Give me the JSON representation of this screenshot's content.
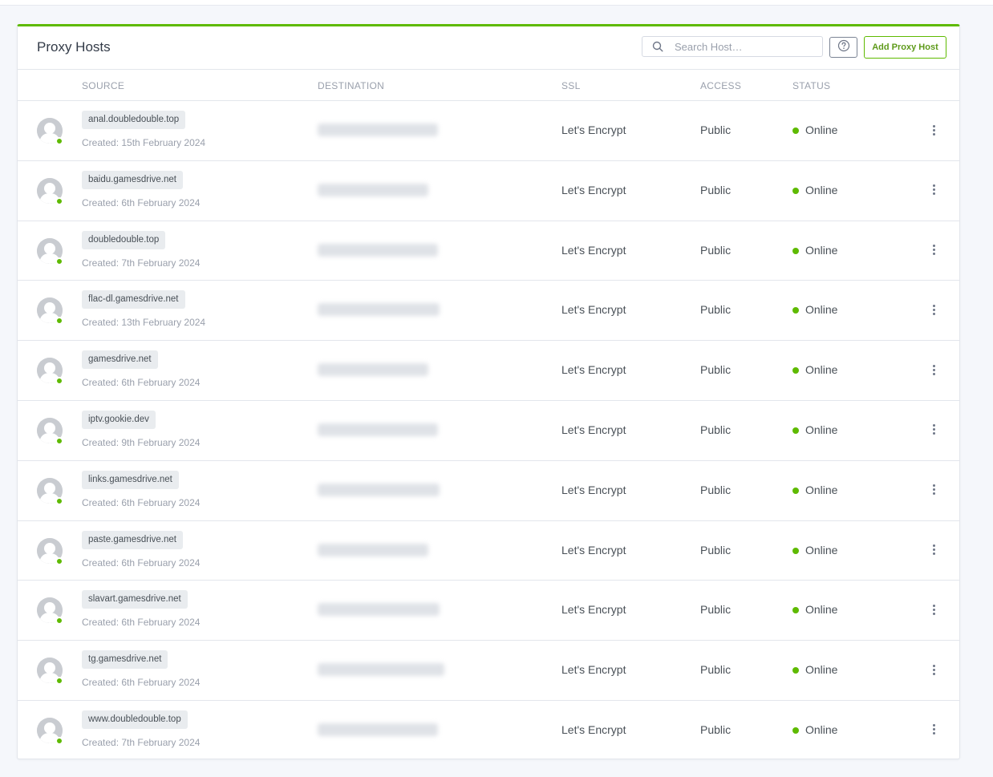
{
  "card": {
    "title": "Proxy Hosts",
    "accent_color": "#5eba00"
  },
  "toolbar": {
    "search_placeholder": "Search Host…",
    "help_icon": "question-circle-icon",
    "add_label": "Add Proxy Host"
  },
  "table": {
    "columns": [
      "SOURCE",
      "DESTINATION",
      "SSL",
      "ACCESS",
      "STATUS"
    ],
    "rows": [
      {
        "domain": "anal.doubledouble.top",
        "created": "Created: 15th February 2024",
        "ssl": "Let's Encrypt",
        "access": "Public",
        "status": "Online"
      },
      {
        "domain": "baidu.gamesdrive.net",
        "created": "Created: 6th February 2024",
        "ssl": "Let's Encrypt",
        "access": "Public",
        "status": "Online"
      },
      {
        "domain": "doubledouble.top",
        "created": "Created: 7th February 2024",
        "ssl": "Let's Encrypt",
        "access": "Public",
        "status": "Online"
      },
      {
        "domain": "flac-dl.gamesdrive.net",
        "created": "Created: 13th February 2024",
        "ssl": "Let's Encrypt",
        "access": "Public",
        "status": "Online"
      },
      {
        "domain": "gamesdrive.net",
        "created": "Created: 6th February 2024",
        "ssl": "Let's Encrypt",
        "access": "Public",
        "status": "Online"
      },
      {
        "domain": "iptv.gookie.dev",
        "created": "Created: 9th February 2024",
        "ssl": "Let's Encrypt",
        "access": "Public",
        "status": "Online"
      },
      {
        "domain": "links.gamesdrive.net",
        "created": "Created: 6th February 2024",
        "ssl": "Let's Encrypt",
        "access": "Public",
        "status": "Online"
      },
      {
        "domain": "paste.gamesdrive.net",
        "created": "Created: 6th February 2024",
        "ssl": "Let's Encrypt",
        "access": "Public",
        "status": "Online"
      },
      {
        "domain": "slavart.gamesdrive.net",
        "created": "Created: 6th February 2024",
        "ssl": "Let's Encrypt",
        "access": "Public",
        "status": "Online"
      },
      {
        "domain": "tg.gamesdrive.net",
        "created": "Created: 6th February 2024",
        "ssl": "Let's Encrypt",
        "access": "Public",
        "status": "Online"
      },
      {
        "domain": "www.doubledouble.top",
        "created": "Created: 7th February 2024",
        "ssl": "Let's Encrypt",
        "access": "Public",
        "status": "Online"
      }
    ]
  },
  "colors": {
    "online": "#5eba00",
    "avatar": "#c9ccd1"
  }
}
